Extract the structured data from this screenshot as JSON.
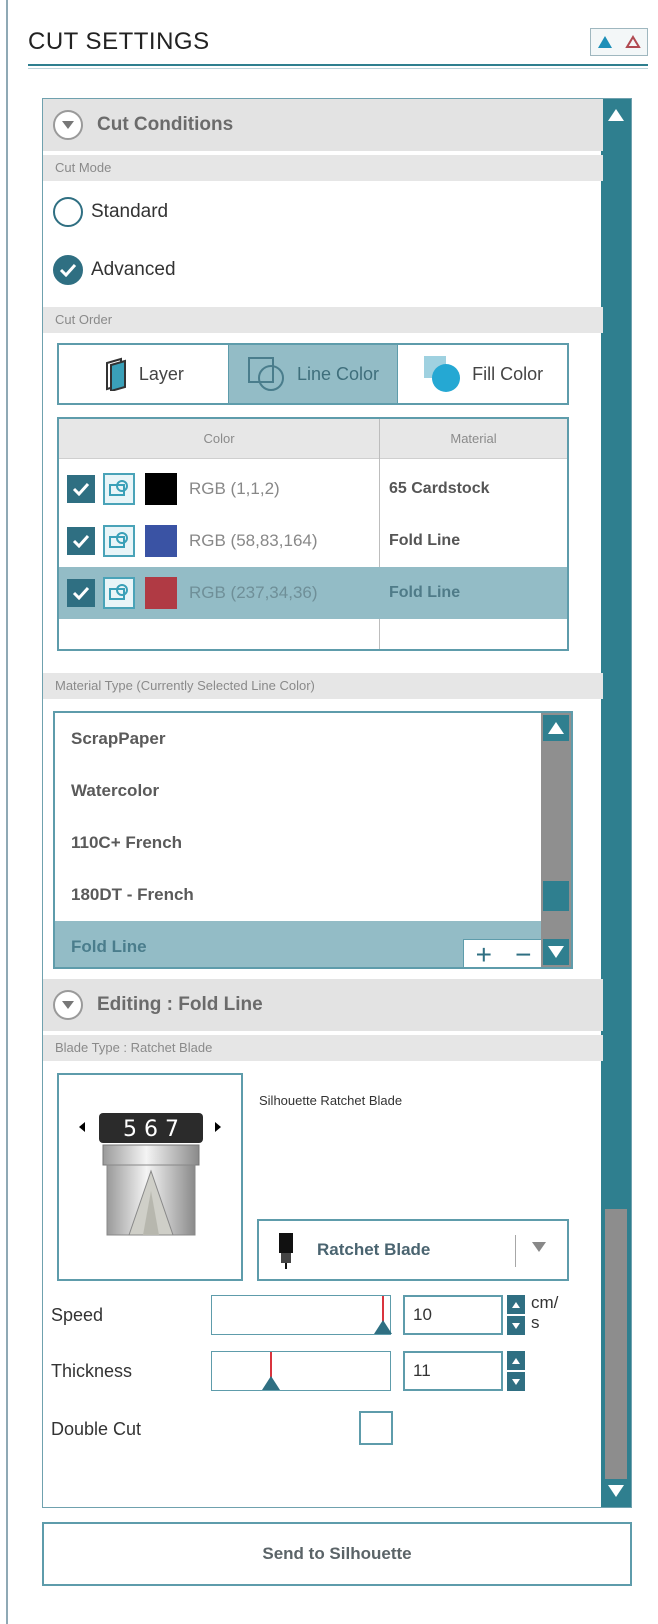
{
  "header": {
    "title": "CUT SETTINGS"
  },
  "cut_conditions": {
    "section_label": "Cut Conditions",
    "cut_mode_label": "Cut Mode",
    "mode_options": [
      {
        "label": "Standard",
        "selected": false
      },
      {
        "label": "Advanced",
        "selected": true
      }
    ],
    "cut_order_label": "Cut Order",
    "cut_order_options": [
      {
        "label": "Layer",
        "selected": false
      },
      {
        "label": "Line Color",
        "selected": true
      },
      {
        "label": "Fill Color",
        "selected": false
      }
    ],
    "color_table": {
      "columns": [
        "Color",
        "Material"
      ],
      "rows": [
        {
          "checked": true,
          "swatch": "#000000",
          "rgb": "RGB (1,1,2)",
          "material": "65 Cardstock",
          "selected": false
        },
        {
          "checked": true,
          "swatch": "#3a53a4",
          "rgb": "RGB (58,83,164)",
          "material": "Fold Line",
          "selected": false
        },
        {
          "checked": true,
          "swatch": "#b03a44",
          "rgb": "RGB (237,34,36)",
          "material": "Fold Line",
          "selected": true
        }
      ]
    },
    "material_type_label": "Material Type (Currently Selected Line Color)",
    "materials": [
      {
        "label": "ScrapPaper",
        "selected": false
      },
      {
        "label": "Watercolor",
        "selected": false
      },
      {
        "label": "110C+ French",
        "selected": false
      },
      {
        "label": "180DT - French",
        "selected": false
      },
      {
        "label": "Fold Line",
        "selected": true
      }
    ],
    "add_symbol": "+",
    "remove_symbol": "−"
  },
  "editing": {
    "section_label": "Editing : Fold Line",
    "blade_type_label": "Blade Type : Ratchet Blade",
    "blade_name": "Silhouette Ratchet Blade",
    "blade_dial_digits": "5 6 7",
    "blade_selected": "Ratchet Blade",
    "speed": {
      "label": "Speed",
      "value": "10",
      "unit": "cm/\ns",
      "slider_fraction": 0.95
    },
    "thickness": {
      "label": "Thickness",
      "value": "11",
      "slider_fraction": 0.33
    },
    "double_cut": {
      "label": "Double Cut",
      "checked": false
    }
  },
  "send_button": "Send to Silhouette",
  "colors": {
    "accent": "#2f7f8f",
    "selection": "#93bcc6",
    "border": "#5e9cab"
  }
}
